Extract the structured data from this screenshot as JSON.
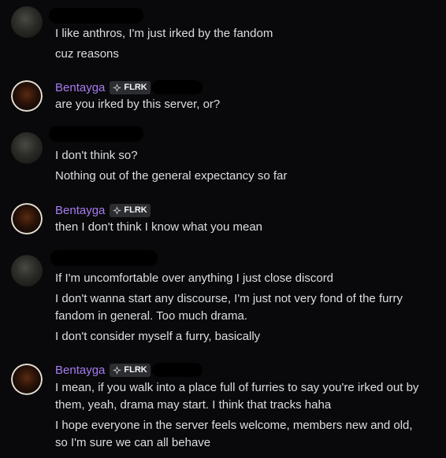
{
  "messages": [
    {
      "author": "",
      "lines": [
        "I like anthros, I'm just irked by the fandom",
        "cuz reasons"
      ]
    },
    {
      "author": "Bentayga",
      "tag": "FLRK",
      "lines": [
        "are you irked by this server, or?"
      ]
    },
    {
      "author": "",
      "lines": [
        "I don't think so?",
        "Nothing out of the general expectancy so far"
      ]
    },
    {
      "author": "Bentayga",
      "tag": "FLRK",
      "lines": [
        "then I don't think I know what you mean"
      ]
    },
    {
      "author": "",
      "lines": [
        "If I'm uncomfortable over anything I just close discord",
        "I don't wanna start any discourse, I'm just not very fond of the furry",
        "fandom in general. Too much drama.",
        "I don't consider myself a furry, basically"
      ]
    },
    {
      "author": "Bentayga",
      "tag": "FLRK",
      "lines": [
        "I mean, if you walk into a place full of furries to say you're irked out by",
        "them, yeah, drama may start. I think that tracks haha",
        "I hope everyone in the server feels welcome, members new and old,",
        "so I'm sure we can all behave"
      ]
    }
  ],
  "colors": {
    "background": "#09090b",
    "author": "#a77bf0",
    "text": "#dbdee1",
    "tag_bg": "#2b2d31"
  },
  "icons": {
    "tag": "sparkle-icon"
  }
}
